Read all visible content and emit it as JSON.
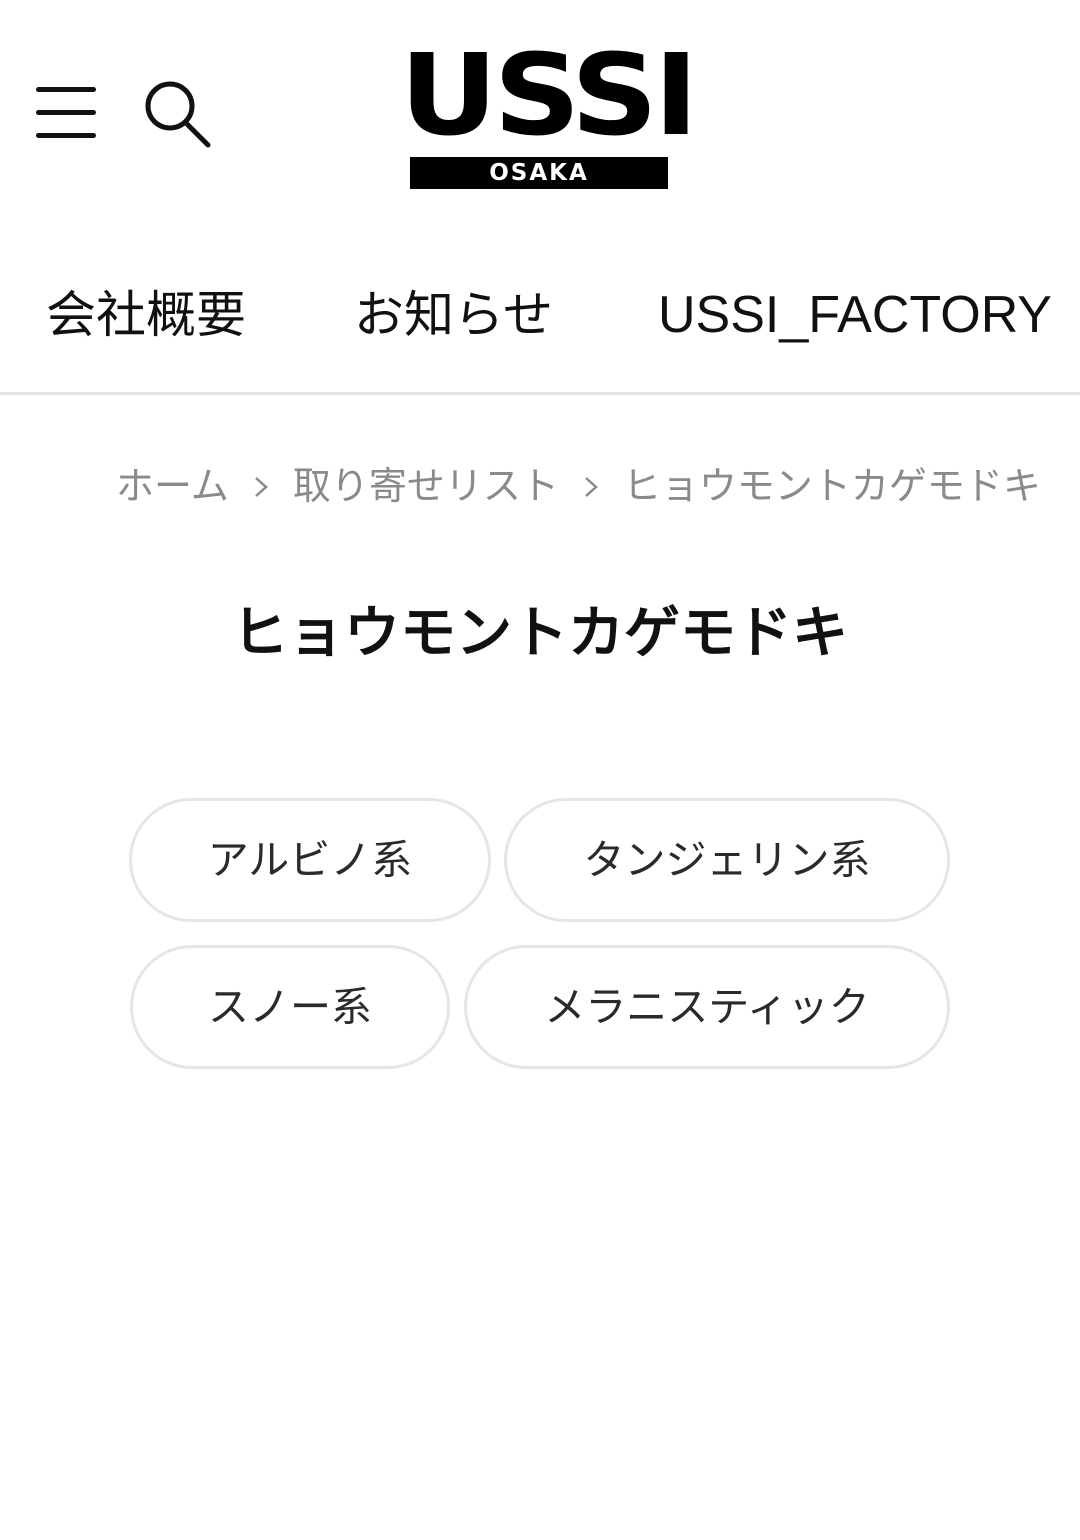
{
  "header": {
    "logo_text": "USSI",
    "logo_sub": "OSAKA",
    "menu_icon": "hamburger-menu-icon",
    "search_icon": "search-icon"
  },
  "nav": {
    "items": [
      {
        "label": "会社概要"
      },
      {
        "label": "お知らせ"
      },
      {
        "label": "USSI_FACTORY"
      }
    ]
  },
  "breadcrumb": {
    "items": [
      {
        "label": "ホーム"
      },
      {
        "label": "取り寄せリスト"
      },
      {
        "label": "ヒョウモントカゲモドキ"
      }
    ],
    "separator_icon": "chevron-right-icon"
  },
  "page": {
    "title": "ヒョウモントカゲモドキ"
  },
  "tags": [
    {
      "label": "アルビノ系"
    },
    {
      "label": "タンジェリン系"
    },
    {
      "label": "スノー系"
    },
    {
      "label": "メラニスティック"
    }
  ],
  "colors": {
    "text": "#111111",
    "muted_text": "#8a8a8a",
    "border": "#e6e6e6",
    "background": "#ffffff"
  }
}
